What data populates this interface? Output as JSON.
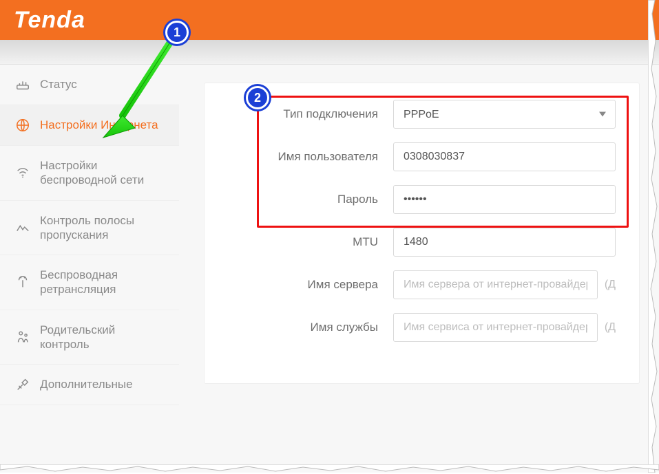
{
  "brand": "Tenda",
  "sidebar": {
    "items": [
      {
        "label": "Статус",
        "icon": "status"
      },
      {
        "label": "Настройки Интернета",
        "icon": "globe",
        "active": true
      },
      {
        "label": "Настройки беспроводной сети",
        "icon": "wifi"
      },
      {
        "label": "Контроль полосы пропускания",
        "icon": "bandwidth"
      },
      {
        "label": "Беспроводная ретрансляция",
        "icon": "repeat"
      },
      {
        "label": "Родительский контроль",
        "icon": "parental"
      },
      {
        "label": "Дополнительные",
        "icon": "tools"
      }
    ]
  },
  "form": {
    "conn_type_label": "Тип подключения",
    "conn_type_value": "PPPoE",
    "username_label": "Имя пользователя",
    "username_value": "0308030837",
    "password_label": "Пароль",
    "password_value": "••••••",
    "mtu_label": "MTU",
    "mtu_value": "1480",
    "server_name_label": "Имя сервера",
    "server_name_placeholder": "Имя сервера от интернет-провайдера",
    "service_name_label": "Имя службы",
    "service_name_placeholder": "Имя сервиса от интернет-провайдера",
    "trail_hint": "(Д"
  },
  "callouts": {
    "one": "1",
    "two": "2"
  }
}
